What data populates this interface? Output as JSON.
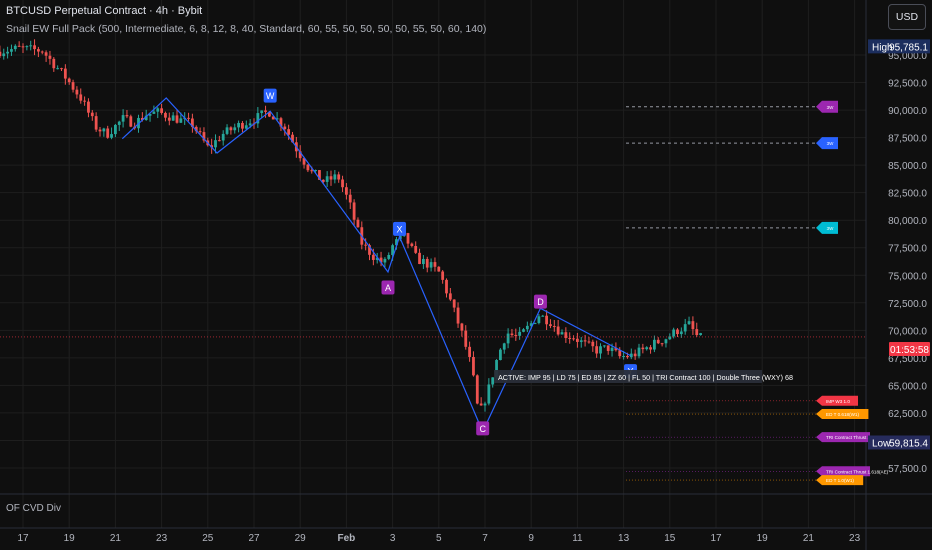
{
  "header": {
    "symbol_title": "BTCUSD Perpetual Contract · 4h · Bybit",
    "indicator_line": "Snail EW Full Pack (500, Intermediate, 6, 8, 12, 8, 40, Standard, 60, 55, 50, 50, 50, 50, 55, 50, 60, 140)",
    "currency_button": "USD"
  },
  "sub_pane": {
    "label": "OF CVD Div"
  },
  "colors": {
    "background": "#0f0f0f",
    "up_candle": "#26a69a",
    "down_candle": "#ef5350",
    "wave_line": "#2962ff",
    "label_blue": "#2962ff",
    "label_purple": "#9c27b0",
    "price_tag_red": "#f23645",
    "low_tag": "#262b5c",
    "high_tag": "#1c2e5e"
  },
  "chart_data": {
    "type": "candlestick",
    "title": "BTCUSD Perpetual Contract · 4h · Bybit",
    "x_axis": {
      "tick_labels": [
        "17",
        "19",
        "21",
        "23",
        "25",
        "27",
        "29",
        "Feb",
        "3",
        "5",
        "7",
        "9",
        "11",
        "13",
        "15",
        "17",
        "19",
        "21",
        "23"
      ],
      "range": [
        "Jan 16",
        "Feb 23"
      ]
    },
    "y_axis": {
      "ticks": [
        57500,
        60000,
        62500,
        65000,
        67500,
        70000,
        72500,
        75000,
        77500,
        80000,
        82500,
        85000,
        87500,
        90000,
        92500,
        95000
      ],
      "tick_labels": [
        "57,500.0",
        "60,000.0",
        "62,500.0",
        "65,000.0",
        "67,500.0",
        "70,000.0",
        "72,500.0",
        "75,000.0",
        "77,500.0",
        "80,000.0",
        "82,500.0",
        "85,000.0",
        "87,500.0",
        "90,000.0",
        "92,500.0",
        "95,000.0"
      ],
      "range": [
        55500,
        97000
      ],
      "grid": true
    },
    "price_path": [
      [
        "Jan 16",
        95300
      ],
      [
        "Jan 17",
        95600
      ],
      [
        "Jan 18",
        95400
      ],
      [
        "Jan 18.5",
        94200
      ],
      [
        "Jan 19",
        93000
      ],
      [
        "Jan 19.7",
        91000
      ],
      [
        "Jan 20.3",
        88500
      ],
      [
        "Jan 20.8",
        87800
      ],
      [
        "Jan 21.5",
        89200
      ],
      [
        "Jan 22",
        88800
      ],
      [
        "Jan 22.5",
        89600
      ],
      [
        "Jan 23",
        89800
      ],
      [
        "Jan 23.7",
        89300
      ],
      [
        "Jan 24.5",
        88700
      ],
      [
        "Jan 25.2",
        86500
      ],
      [
        "Jan 25.8",
        87800
      ],
      [
        "Jan 26.5",
        88600
      ],
      [
        "Jan 27.2",
        89200
      ],
      [
        "Jan 27.8",
        89900
      ],
      [
        "Jan 28.5",
        88500
      ],
      [
        "Jan 29",
        86500
      ],
      [
        "Jan 29.6",
        84500
      ],
      [
        "Jan 30.2",
        83500
      ],
      [
        "Jan 30.8",
        84000
      ],
      [
        "Jan 31.3",
        81500
      ],
      [
        "Jan 31.8",
        78000
      ],
      [
        "Feb 1.3",
        76800
      ],
      [
        "Feb 1.8",
        76000
      ],
      [
        "Feb 2.2",
        77800
      ],
      [
        "Feb 2.7",
        78500
      ],
      [
        "Feb 3.2",
        76500
      ],
      [
        "Feb 3.7",
        76000
      ],
      [
        "Feb 4.2",
        75200
      ],
      [
        "Feb 4.7",
        72500
      ],
      [
        "Feb 5.2",
        69500
      ],
      [
        "Feb 5.6",
        66500
      ],
      [
        "Feb 5.9",
        62200
      ],
      [
        "Feb 6.3",
        64500
      ],
      [
        "Feb 6.7",
        67500
      ],
      [
        "Feb 7.1",
        69800
      ],
      [
        "Feb 7.6",
        69300
      ],
      [
        "Feb 8.0",
        70200
      ],
      [
        "Feb 8.5",
        71400
      ],
      [
        "Feb 9.0",
        70800
      ],
      [
        "Feb 9.5",
        69700
      ],
      [
        "Feb 10.0",
        69400
      ],
      [
        "Feb 10.5",
        68700
      ],
      [
        "Feb 11.0",
        68200
      ],
      [
        "Feb 11.5",
        68400
      ],
      [
        "Feb 12.0",
        67600
      ],
      [
        "Feb 12.5",
        67700
      ],
      [
        "Feb 13.0",
        68200
      ],
      [
        "Feb 13.5",
        68800
      ],
      [
        "Feb 14.0",
        69300
      ],
      [
        "Feb 14.5",
        70000
      ],
      [
        "Feb 15.0",
        70500
      ],
      [
        "Feb 15.4",
        69300
      ]
    ],
    "wave_labels": [
      {
        "label": "W",
        "date": "Jan 27.7",
        "price": 90400,
        "color": "blue",
        "position": "above"
      },
      {
        "label": "X",
        "date": "Feb 2.3",
        "price": 78300,
        "color": "blue",
        "position": "above"
      },
      {
        "label": "A",
        "date": "Feb 1.8",
        "price": 74800,
        "color": "purple",
        "position": "below"
      },
      {
        "label": "C",
        "date": "Feb 5.9",
        "price": 62000,
        "color": "purple",
        "position": "below"
      },
      {
        "label": "D",
        "date": "Feb 8.4",
        "price": 71700,
        "color": "purple",
        "position": "above"
      },
      {
        "label": "Y",
        "date": "Feb 12.3",
        "price": 67200,
        "color": "blue",
        "position": "below"
      }
    ],
    "wave_path": [
      [
        "Jan 21.3",
        87400
      ],
      [
        "Jan 23.2",
        91100
      ],
      [
        "Jan 25.4",
        86100
      ],
      [
        "Jan 27.7",
        89900
      ],
      [
        "Feb 1.8",
        75300
      ],
      [
        "Feb 2.3",
        78500
      ],
      [
        "Feb 5.9",
        60800
      ],
      [
        "Feb 8.4",
        72000
      ],
      [
        "Feb 12.3",
        67700
      ]
    ],
    "targets": [
      {
        "label": "3W",
        "price": 90300,
        "color": "#9c27b0",
        "dashed": true
      },
      {
        "label": "3W",
        "price": 87000,
        "color": "#2962ff",
        "dashed": true
      },
      {
        "label": "3W",
        "price": 79300,
        "color": "#00bcd4",
        "dashed": true
      },
      {
        "label": "IMP W3 1.0",
        "price": 63600,
        "color": "#f23645",
        "dashed": false
      },
      {
        "label": "ED T 0.618(W1)",
        "price": 62400,
        "color": "#ff9800",
        "dashed": false
      },
      {
        "label": "TRI Contract Thrust 1.0",
        "price": 60300,
        "color": "#9c27b0",
        "dashed": false
      },
      {
        "label": "TRI Contract Thrust 1.618(AE)",
        "price": 57200,
        "color": "#9c27b0",
        "dashed": false
      },
      {
        "label": "ED T 1.0(W1)",
        "price": 56400,
        "color": "#ff9800",
        "dashed": false
      }
    ],
    "status_box": "ACTIVE: IMP 95 | LD 75 | ED 85 | ZZ 60 | FL 50 | TRI Contract 100 | Double Three (WXY) 68",
    "high": {
      "label": "High",
      "value": "95,785.1",
      "price": 95785
    },
    "low": {
      "label": "Low",
      "value": "59,815.4",
      "price": 59815
    },
    "last_price": {
      "value": "01:53:58",
      "price": 68300,
      "line_price": 69400
    },
    "grid": true,
    "legend": "none"
  }
}
